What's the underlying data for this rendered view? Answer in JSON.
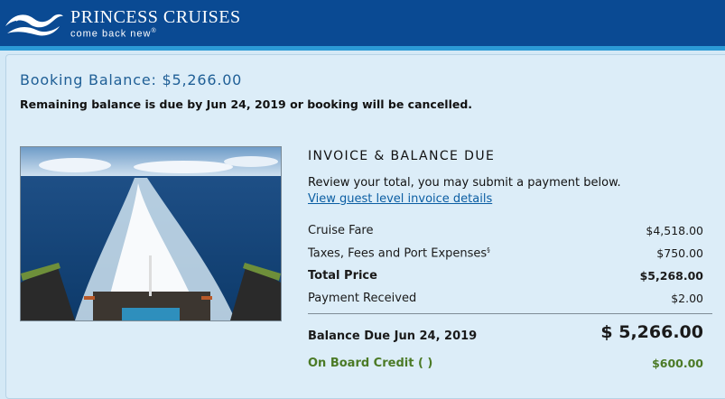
{
  "header": {
    "brand": "PRINCESS CRUISES",
    "tagline": "come back new",
    "tagline_mark": "®",
    "logo_icon": "seawitch-wave-logo-icon",
    "background_color": "#0a4a93",
    "stripe_color": "#2b9ad6"
  },
  "booking": {
    "balance_title": "Booking Balance: $5,266.00",
    "due_notice": "Remaining balance is due by Jun 24, 2019 or booking will be cancelled."
  },
  "invoice": {
    "title": "INVOICE & BALANCE DUE",
    "review_text": "Review your total, you may submit a payment below.",
    "details_link": "View guest level invoice details",
    "rows": [
      {
        "label": "Cruise Fare",
        "amount": "$4,518.00",
        "mark": ""
      },
      {
        "label": "Taxes, Fees and Port Expenses",
        "amount": "$750.00",
        "mark": "§"
      },
      {
        "label": "Total Price",
        "amount": "$5,268.00",
        "mark": ""
      },
      {
        "label": "Payment Received",
        "amount": "$2.00",
        "mark": ""
      }
    ],
    "balance_due": {
      "label": "Balance Due Jun 24, 2019",
      "amount": "$ 5,266.00"
    },
    "onboard_credit": {
      "label": "On Board Credit ( )",
      "amount": "$600.00",
      "color": "#4b7a26"
    }
  },
  "image": {
    "subject": "ship-wake-ocean-photo"
  }
}
